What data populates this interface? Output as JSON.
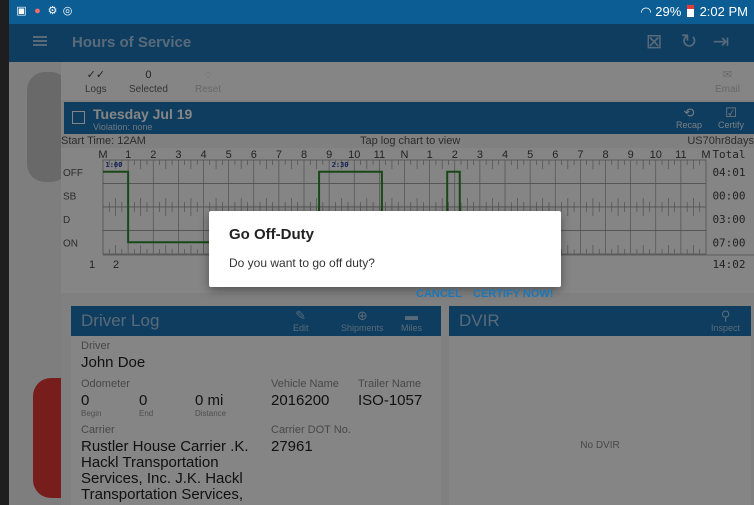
{
  "status_bar": {
    "battery": "29%",
    "time": "2:02 PM",
    "left_icons": [
      "gallery-icon",
      "alert-icon",
      "hotspot-icon",
      "sync-icon"
    ]
  },
  "app_bar": {
    "title": "Hours of Service",
    "icons": [
      "menu-icon",
      "export-icon",
      "refresh-icon",
      "logout-icon"
    ]
  },
  "toolbar": {
    "logs_label": "Logs",
    "selected_count": "0",
    "selected_label": "Selected",
    "reset_label": "Reset",
    "email_label": "Email"
  },
  "day": {
    "date": "Tuesday Jul 19",
    "violation": "Violation: none",
    "recap_label": "Recap",
    "certify_label": "Certify"
  },
  "log_info": {
    "start_time": "Start Time: 12AM",
    "tap_hint": "Tap log chart to view",
    "ruleset": "US70hr8days"
  },
  "chart_data": {
    "type": "line",
    "title": "",
    "hour_labels": [
      "M",
      "1",
      "2",
      "3",
      "4",
      "5",
      "6",
      "7",
      "8",
      "9",
      "10",
      "11",
      "N",
      "1",
      "2",
      "3",
      "4",
      "5",
      "6",
      "7",
      "8",
      "9",
      "10",
      "11",
      "M"
    ],
    "total_header": "Total",
    "statuses": [
      "OFF",
      "SB",
      "D",
      "ON"
    ],
    "totals": [
      "04:01",
      "00:00",
      "03:00",
      "07:00"
    ],
    "grand_total": "14:02",
    "bottom_labels": [
      "1",
      "2"
    ],
    "event_labels": [
      {
        "text": "1:00",
        "hour": 0.1,
        "status": "OFF"
      },
      {
        "text": "2:30",
        "hour": 9.1,
        "status": "OFF"
      },
      {
        "text": "7:0",
        "hour": 4.9,
        "status": "ON"
      }
    ],
    "series": [
      {
        "points": [
          {
            "hour": 0,
            "status": "OFF"
          },
          {
            "hour": 1,
            "status": "OFF"
          },
          {
            "hour": 1,
            "status": "ON"
          },
          {
            "hour": 8.6,
            "status": "ON"
          },
          {
            "hour": 8.6,
            "status": "OFF"
          },
          {
            "hour": 11.1,
            "status": "OFF"
          },
          {
            "hour": 11.1,
            "status": "ON"
          },
          {
            "hour": 13.7,
            "status": "ON"
          },
          {
            "hour": 13.7,
            "status": "OFF"
          },
          {
            "hour": 14.2,
            "status": "OFF"
          },
          {
            "hour": 14.2,
            "status": "ON"
          }
        ]
      }
    ],
    "line_color": "#2e8b2e"
  },
  "driver_log": {
    "title": "Driver Log",
    "edit_label": "Edit",
    "shipments_label": "Shipments",
    "miles_label": "Miles",
    "driver_label": "Driver",
    "driver_name": "John Doe",
    "odometer_label": "Odometer",
    "odo_begin": "0",
    "odo_begin_label": "Begin",
    "odo_end": "0",
    "odo_end_label": "End",
    "odo_distance": "0 mi",
    "odo_distance_label": "Distance",
    "vehicle_label": "Vehicle Name",
    "vehicle": "2016200",
    "trailer_label": "Trailer Name",
    "trailer": "ISO-1057",
    "carrier_label": "Carrier",
    "carrier_lines": [
      "Rustler House Carrier .K.",
      "Hackl Transportation",
      "Services, Inc. J.K. Hackl",
      "Transportation Services,"
    ],
    "dot_label": "Carrier DOT No.",
    "dot": "27961"
  },
  "dvir": {
    "title": "DVIR",
    "inspect_label": "Inspect",
    "empty": "No DVIR"
  },
  "dialog": {
    "title": "Go Off-Duty",
    "message": "Do you want to go off duty?",
    "cancel": "CANCEL",
    "certify": "CERTIFY NOW!"
  },
  "colors": {
    "primary": "#1c76b8",
    "status_bar": "#0b5d93",
    "graph_line": "#2e8b2e"
  }
}
